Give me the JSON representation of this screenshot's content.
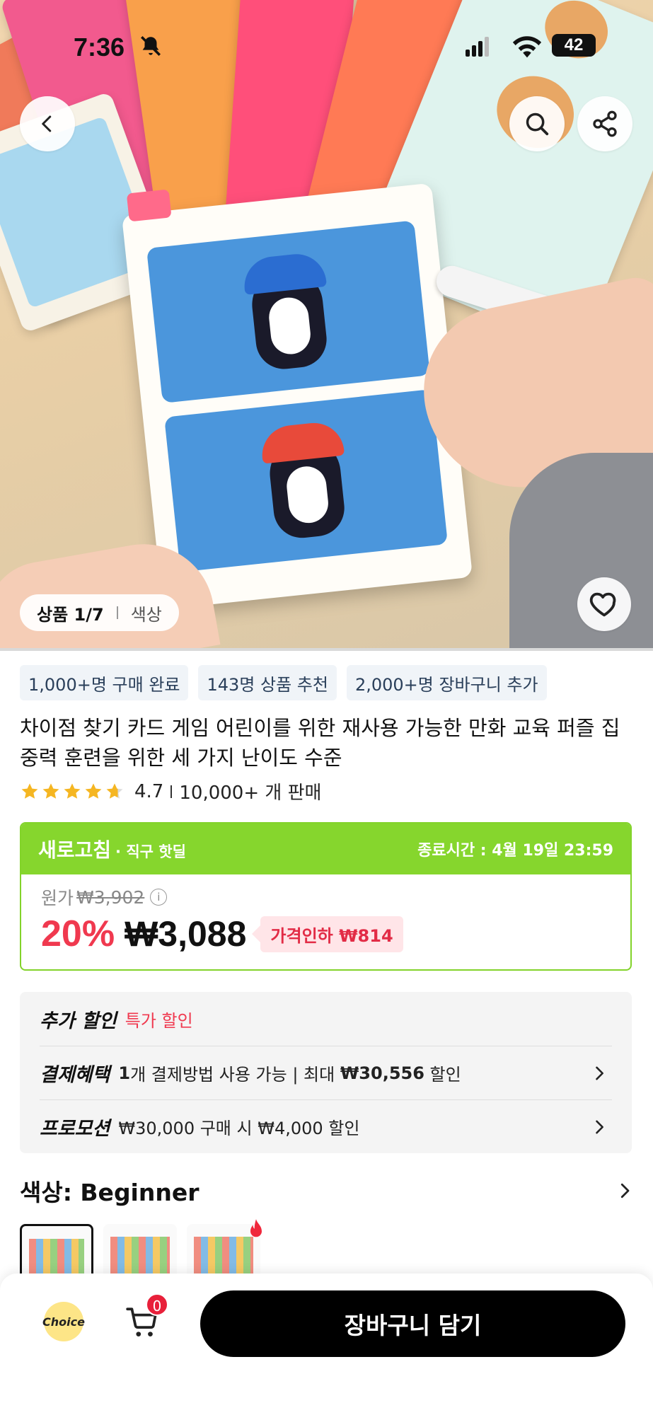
{
  "status_bar": {
    "time": "7:36",
    "battery": "42"
  },
  "hero": {
    "counter_main": "상품 1/7",
    "counter_sub": "색상"
  },
  "chips": [
    "1,000+명 구매 완료",
    "143명 상품 추천",
    "2,000+명 장바구니 추가"
  ],
  "product": {
    "title": "차이점 찾기 카드 게임 어린이를 위한 재사용 가능한 만화 교육 퍼즐 집중력 훈련을 위한 세 가지 난이도 수준",
    "rating": "4.7",
    "rating_stars": 4.7,
    "sold": "10,000+ 개 판매"
  },
  "deal": {
    "brand": "새로고침",
    "sub": "· 직구 핫딜",
    "end_time": "종료시간 : 4월 19일 23:59",
    "original_label": "원가",
    "original_price": "₩3,902",
    "info_glyph": "i",
    "discount_pct": "20%",
    "price": "₩3,088",
    "drop_label": "가격인하 ₩814"
  },
  "extra": {
    "row1_label": "추가 할인",
    "row1_value": "특가 할인",
    "row2_label": "결제혜택",
    "row2_count": "1",
    "row2_text": "개 결제방법 사용 가능 | 최대 ",
    "row2_amount": "₩30,556",
    "row2_suffix": " 할인",
    "row3_label": "프로모션",
    "row3_text": "₩30,000 구매 시 ₩4,000 할인"
  },
  "color": {
    "label": "색상: Beginner"
  },
  "bottom": {
    "choice": "Choice",
    "cart_count": "0",
    "add_to_cart": "장바구니 담기"
  },
  "colors": {
    "accent_green": "#86d62d",
    "sale_red": "#f0394f",
    "button_black": "#000000"
  }
}
